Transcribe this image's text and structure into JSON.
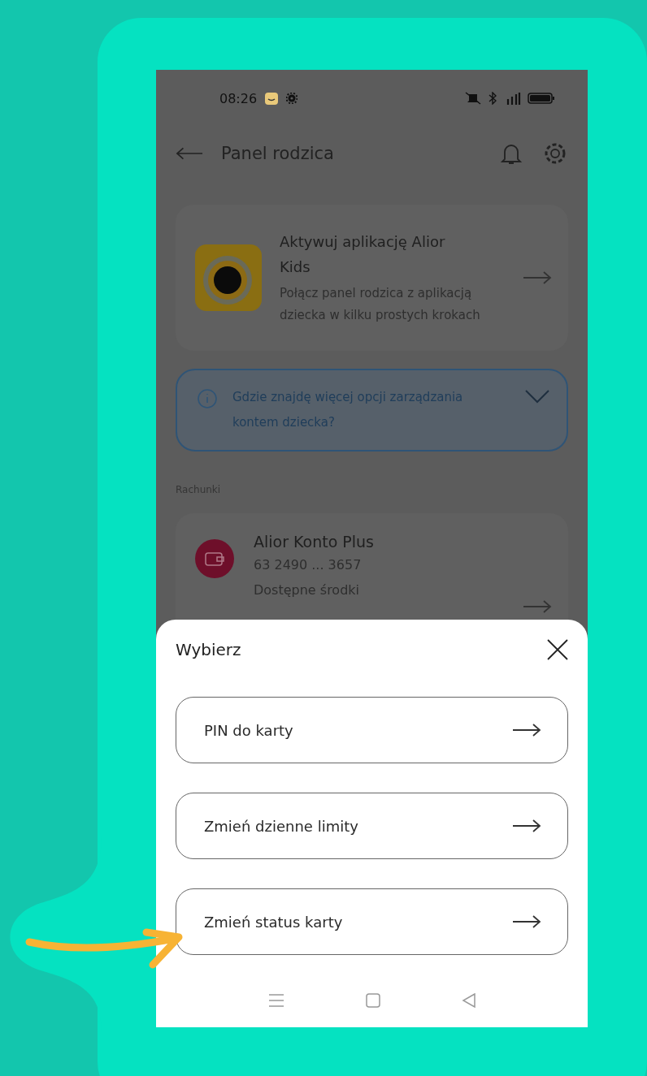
{
  "status_bar": {
    "time": "08:26"
  },
  "header": {
    "title": "Panel rodzica"
  },
  "promo_card": {
    "title": "Aktywuj aplikację Alior Kids",
    "subtitle": "Połącz panel rodzica z aplikacją dziecka w kilku prostych krokach"
  },
  "info_box": {
    "text": "Gdzie znajdę więcej opcji zarządzania kontem dziecka?",
    "expanded": false
  },
  "section_label": "Rachunki",
  "account": {
    "name": "Alior Konto Plus",
    "number": "63 2490 ... 3657",
    "balance_label": "Dostępne środki"
  },
  "sheet": {
    "title": "Wybierz",
    "options": [
      {
        "label": "PIN do karty"
      },
      {
        "label": "Zmień dzienne limity"
      },
      {
        "label": "Zmień status karty"
      }
    ]
  }
}
